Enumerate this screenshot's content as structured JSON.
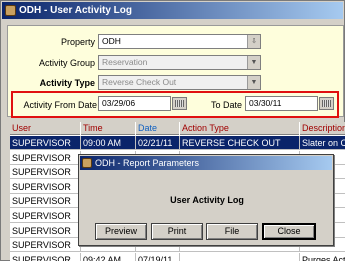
{
  "window": {
    "title": "ODH - User Activity Log"
  },
  "filters": {
    "property_label": "Property",
    "property_value": "ODH",
    "activity_group_label": "Activity Group",
    "activity_group_value": "Reservation",
    "activity_type_label": "Activity Type",
    "activity_type_value": "Reverse Check Out",
    "from_date_label": "Activity From Date",
    "from_date_value": "03/29/06",
    "to_date_label": "To Date",
    "to_date_value": "03/30/11"
  },
  "table": {
    "columns": [
      "User",
      "Time",
      "Date",
      "Action Type",
      "Description"
    ],
    "rows": [
      [
        "SUPERVISOR",
        "09:00 AM",
        "02/21/11",
        "REVERSE CHECK OUT",
        "Slater on C"
      ],
      [
        "SUPERVISOR",
        "",
        "",
        "",
        ""
      ],
      [
        "SUPERVISOR",
        "",
        "",
        "",
        ""
      ],
      [
        "SUPERVISOR",
        "",
        "",
        "",
        ""
      ],
      [
        "SUPERVISOR",
        "",
        "",
        "",
        ""
      ],
      [
        "SUPERVISOR",
        "",
        "",
        "",
        ""
      ],
      [
        "SUPERVISOR",
        "",
        "",
        "",
        ""
      ],
      [
        "SUPERVISOR",
        "",
        "",
        "",
        ""
      ],
      [
        "SUPERVISOR",
        "09:42 AM",
        "07/19/11",
        "",
        "Purges Acti"
      ]
    ]
  },
  "dialog": {
    "title": "ODH - Report Parameters",
    "heading": "User Activity Log",
    "buttons": [
      "Preview",
      "Print",
      "File",
      "Close"
    ]
  }
}
